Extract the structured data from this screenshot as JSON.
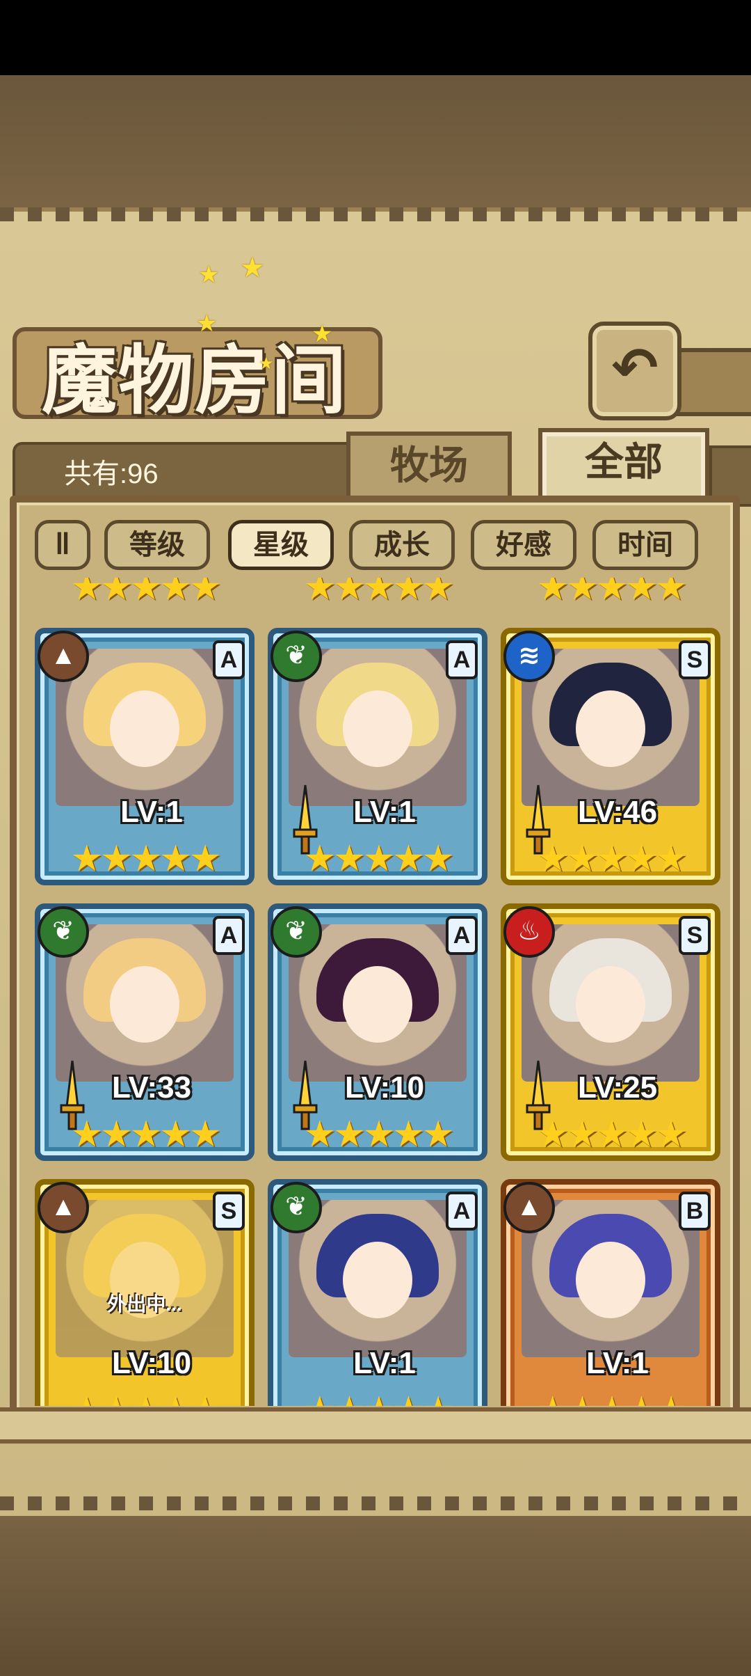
{
  "title": "魔物房间",
  "count_label": "共有:96",
  "tabs": [
    {
      "label": "牧场",
      "active": false
    },
    {
      "label": "全部",
      "active": true
    }
  ],
  "sort": {
    "pause_icon": "‖",
    "options": [
      {
        "label": "等级",
        "active": false
      },
      {
        "label": "星级",
        "active": true
      },
      {
        "label": "成长",
        "active": false
      },
      {
        "label": "好感",
        "active": false
      },
      {
        "label": "时间",
        "active": false
      }
    ]
  },
  "back_icon": "↶",
  "element_glyphs": {
    "earth": "▲",
    "leaf": "❦",
    "water": "≋",
    "fire": "♨"
  },
  "monsters": [
    {
      "rank": "A",
      "element": "earth",
      "level": "LV:1",
      "stars": "★★★★★",
      "weapon": false,
      "hair": "#f6d37a",
      "away": ""
    },
    {
      "rank": "A",
      "element": "leaf",
      "level": "LV:1",
      "stars": "★★★★★",
      "weapon": true,
      "hair": "#f1d98a",
      "away": ""
    },
    {
      "rank": "S",
      "element": "water",
      "level": "LV:46",
      "stars": "★★★★★",
      "weapon": true,
      "hair": "#20243e",
      "away": ""
    },
    {
      "rank": "A",
      "element": "leaf",
      "level": "LV:33",
      "stars": "★★★★★",
      "weapon": true,
      "hair": "#f2cc82",
      "away": ""
    },
    {
      "rank": "A",
      "element": "leaf",
      "level": "LV:10",
      "stars": "★★★★★",
      "weapon": true,
      "hair": "#3d1a3a",
      "away": ""
    },
    {
      "rank": "S",
      "element": "fire",
      "level": "LV:25",
      "stars": "★★★★★",
      "weapon": true,
      "hair": "#e9e4dc",
      "away": ""
    },
    {
      "rank": "S",
      "element": "earth",
      "level": "LV:10",
      "stars": "★★★★★",
      "weapon": false,
      "hair": "#f6d37a",
      "away": "外出中..."
    },
    {
      "rank": "A",
      "element": "leaf",
      "level": "LV:1",
      "stars": "★★★★★",
      "weapon": false,
      "hair": "#2f3a8a",
      "away": ""
    },
    {
      "rank": "B",
      "element": "earth",
      "level": "LV:1",
      "stars": "★★★★★",
      "weapon": false,
      "hair": "#4b4ab0",
      "away": ""
    }
  ],
  "colors": {
    "parchment": "#d9c795",
    "frame": "#7a5f3a",
    "rarity_a": "#6aa8c8",
    "rarity_s": "#f2c62a",
    "rarity_b": "#e0883c"
  }
}
